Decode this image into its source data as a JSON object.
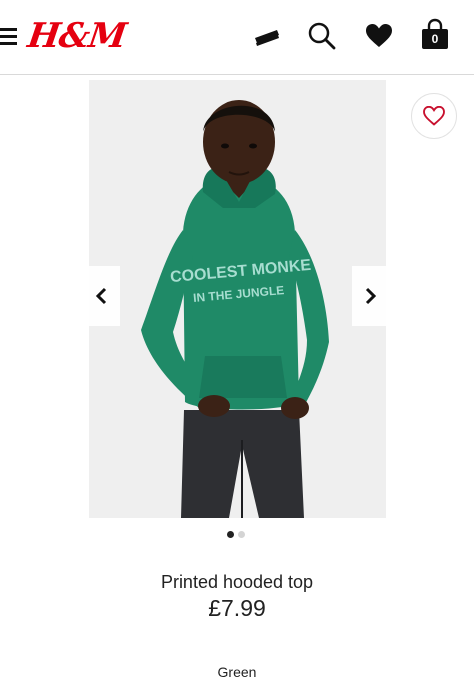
{
  "header": {
    "logo": "H&M",
    "bag_count": "0",
    "icons": [
      "menu-icon",
      "membership-card-icon",
      "search-icon",
      "heart-icon",
      "shopping-bag-icon"
    ]
  },
  "product": {
    "image_print_line1": "COOLEST MONKE",
    "image_print_line2": "IN THE JUNGLE",
    "title": "Printed hooded top",
    "price": "£7.99",
    "color": "Green"
  },
  "gallery": {
    "slide_count": 2,
    "active_slide": 1
  },
  "colors": {
    "brand_red": "#e50010",
    "hoodie_green": "#1f8a67",
    "text": "#222222"
  }
}
